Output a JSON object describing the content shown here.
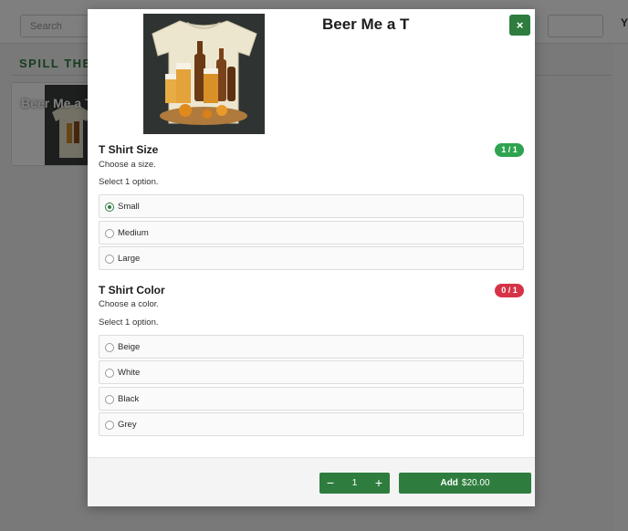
{
  "background": {
    "search_placeholder": "Search",
    "top_right_text": "Y",
    "category_title": "SPILL THE T",
    "card_title": "Beer Me a T"
  },
  "modal": {
    "title": "Beer Me a T",
    "close_label": "×",
    "sections": [
      {
        "title": "T Shirt Size",
        "subtitle": "Choose a size.",
        "hint": "Select 1 option.",
        "badge": "1 / 1",
        "badge_status": "satisfied",
        "options": [
          {
            "label": "Small",
            "selected": true
          },
          {
            "label": "Medium",
            "selected": false
          },
          {
            "label": "Large",
            "selected": false
          }
        ]
      },
      {
        "title": "T Shirt Color",
        "subtitle": "Choose a color.",
        "hint": "Select 1 option.",
        "badge": "0 / 1",
        "badge_status": "required",
        "options": [
          {
            "label": "Beige",
            "selected": false
          },
          {
            "label": "White",
            "selected": false
          },
          {
            "label": "Black",
            "selected": false
          },
          {
            "label": "Grey",
            "selected": false
          }
        ]
      }
    ],
    "footer": {
      "quantity": "1",
      "minus_label": "−",
      "plus_label": "+",
      "add_label": "Add",
      "price": "$20.00"
    }
  },
  "colors": {
    "accent_green": "#2e7d3e",
    "badge_ok": "#2fa34f",
    "badge_required": "#d63346"
  },
  "icons": {
    "close": "close-icon",
    "minus": "minus-icon",
    "plus": "plus-icon"
  }
}
